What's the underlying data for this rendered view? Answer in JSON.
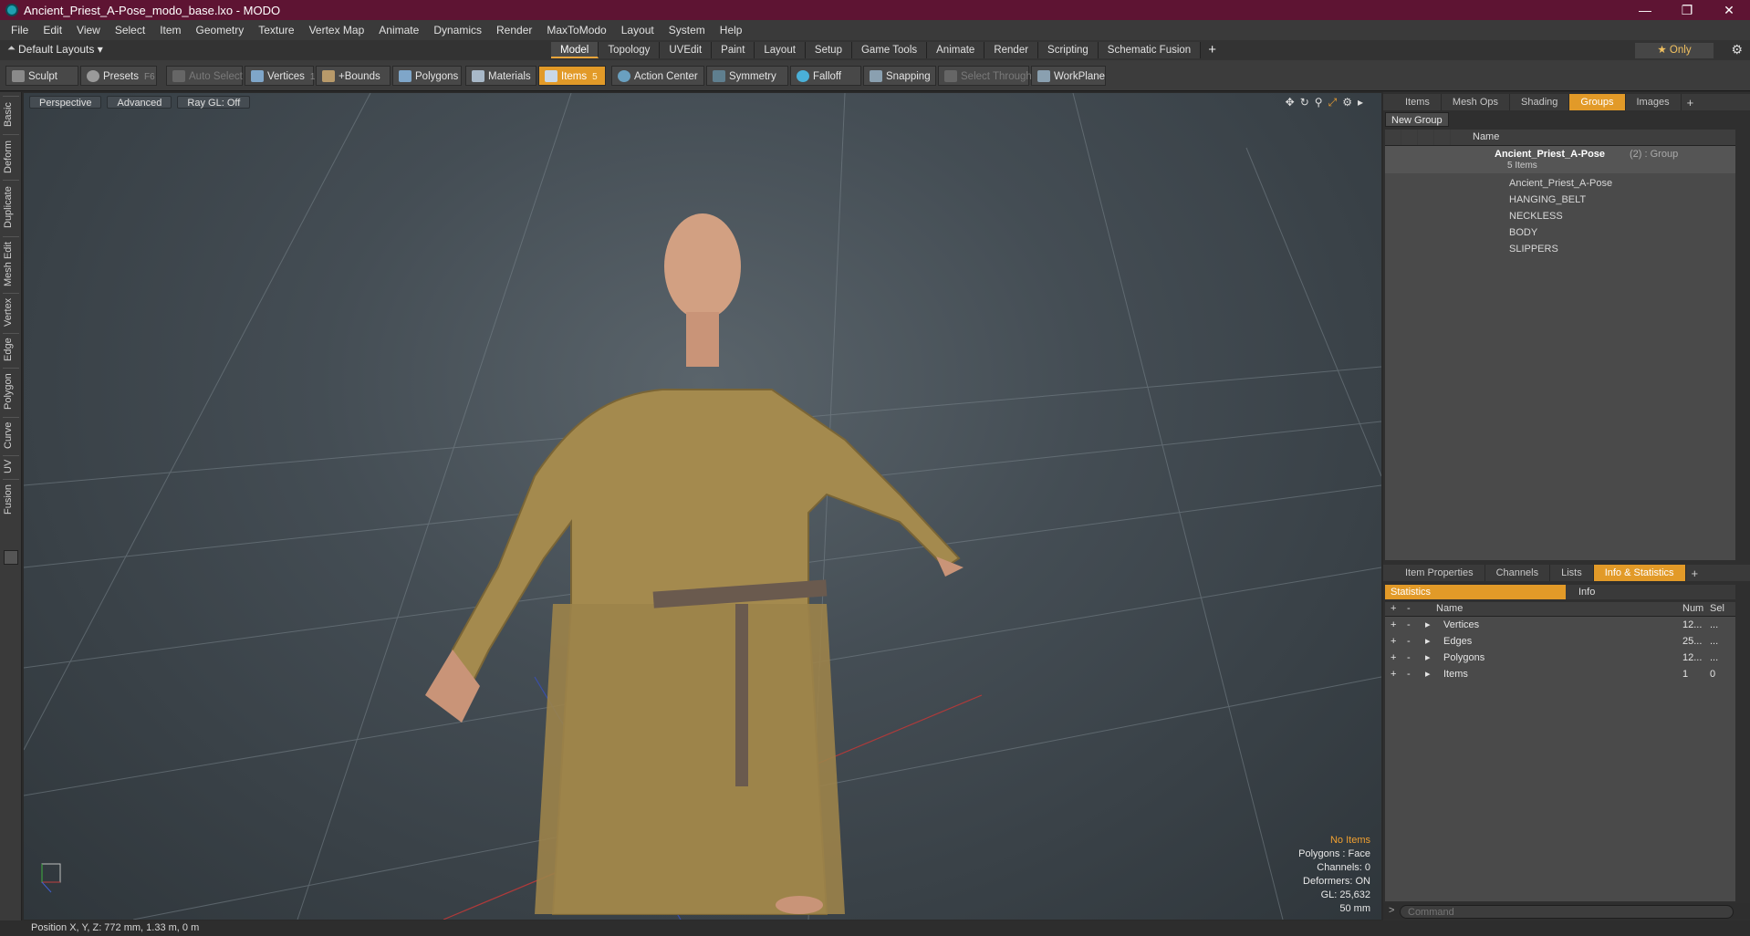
{
  "window": {
    "title": "Ancient_Priest_A-Pose_modo_base.lxo - MODO",
    "controls": [
      "—",
      "❐",
      "✕"
    ]
  },
  "menu": [
    "File",
    "Edit",
    "View",
    "Select",
    "Item",
    "Geometry",
    "Texture",
    "Vertex Map",
    "Animate",
    "Dynamics",
    "Render",
    "MaxToModo",
    "Layout",
    "System",
    "Help"
  ],
  "layout_bar": {
    "layouts_label": "Default Layouts ▾",
    "tabs": [
      "Model",
      "Topology",
      "UVEdit",
      "Paint",
      "Layout",
      "Setup",
      "Game Tools",
      "Animate",
      "Render",
      "Scripting",
      "Schematic Fusion"
    ],
    "active_tab": "Model",
    "add": "+",
    "only_label": "★  Only",
    "gear": "⚙"
  },
  "toolbar": {
    "sculpt": "Sculpt",
    "presets": "Presets",
    "presets_key": "F6",
    "auto_select": "Auto Select",
    "vertices": "Vertices",
    "vertices_num": "1",
    "bounds": "+Bounds",
    "polygons": "Polygons",
    "materials": "Materials",
    "items": "Items",
    "items_num": "5",
    "action_center": "Action Center",
    "symmetry": "Symmetry",
    "falloff": "Falloff",
    "snapping": "Snapping",
    "select_through": "Select Through",
    "workplane": "WorkPlane"
  },
  "left_tabs": [
    "Basic",
    "Deform",
    "Duplicate",
    "Mesh Edit",
    "Vertex",
    "Edge",
    "Polygon",
    "Curve",
    "UV",
    "Fusion"
  ],
  "viewport": {
    "mode": "Perspective",
    "shading": "Advanced",
    "raygl": "Ray GL: Off",
    "stats": {
      "selection": "No Items",
      "polygons": "Polygons : Face",
      "channels": "Channels: 0",
      "deformers": "Deformers: ON",
      "gl": "GL: 25,632",
      "focal": "50 mm"
    }
  },
  "groups_panel": {
    "tabs": [
      "Items",
      "Mesh Ops",
      "Shading",
      "Groups",
      "Images"
    ],
    "active_tab": "Groups",
    "new_group": "New Group",
    "col_name": "Name",
    "group": {
      "name": "Ancient_Priest_A-Pose",
      "suffix": "(2) : Group",
      "count": "5 Items"
    },
    "items": [
      "Ancient_Priest_A-Pose",
      "HANGING_BELT",
      "NECKLESS",
      "BODY",
      "SLIPPERS"
    ]
  },
  "info_panel": {
    "tabs": [
      "Item Properties",
      "Channels",
      "Lists",
      "Info & Statistics"
    ],
    "active_tab": "Info & Statistics",
    "sub_tabs": {
      "statistics": "Statistics",
      "info": "Info"
    },
    "headers": {
      "plus": "+",
      "minus": "-",
      "name": "Name",
      "num": "Num",
      "sel": "Sel"
    },
    "rows": [
      {
        "name": "Vertices",
        "num": "12...",
        "sel": "..."
      },
      {
        "name": "Edges",
        "num": "25...",
        "sel": "..."
      },
      {
        "name": "Polygons",
        "num": "12...",
        "sel": "..."
      },
      {
        "name": "Items",
        "num": "1",
        "sel": "0"
      }
    ],
    "command_placeholder": "Command"
  },
  "status_bar": {
    "position": "Position X, Y, Z:   772 mm, 1.33 m, 0 m"
  }
}
